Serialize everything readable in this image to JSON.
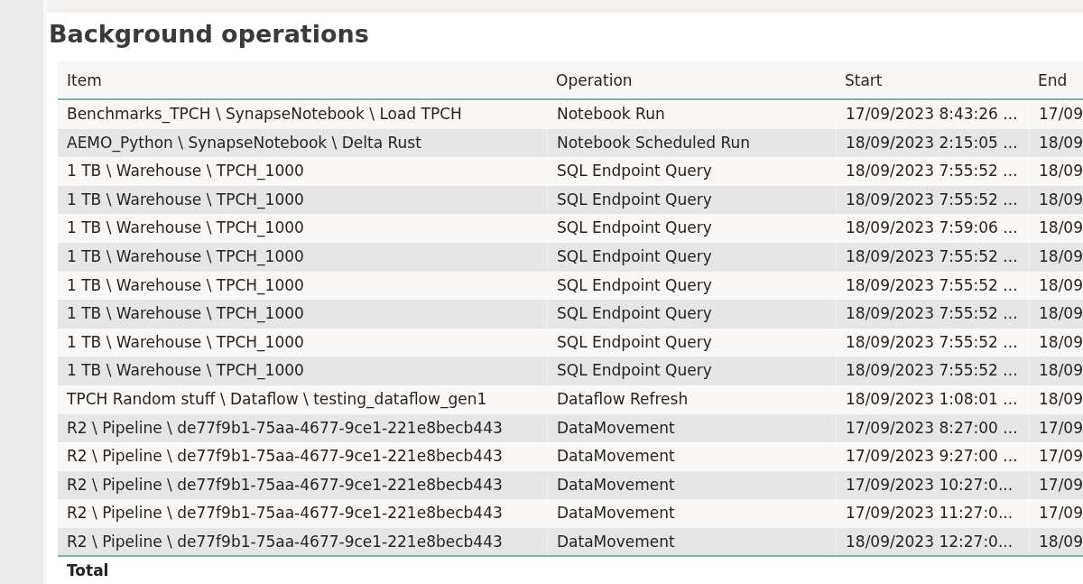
{
  "title": "Background operations",
  "table": {
    "columns": [
      "Item",
      "Operation",
      "Start",
      "End"
    ],
    "rows": [
      [
        "Benchmarks_TPCH \\ SynapseNotebook \\ Load TPCH",
        "Notebook Run",
        "17/09/2023 8:43:26 ...",
        "17/09"
      ],
      [
        "AEMO_Python \\ SynapseNotebook \\ Delta Rust",
        "Notebook Scheduled Run",
        "18/09/2023 2:15:05 ...",
        "18/09"
      ],
      [
        "1 TB \\ Warehouse \\ TPCH_1000",
        "SQL Endpoint Query",
        "18/09/2023 7:55:52 ...",
        "18/09"
      ],
      [
        "1 TB \\ Warehouse \\ TPCH_1000",
        "SQL Endpoint Query",
        "18/09/2023 7:55:52 ...",
        "18/09"
      ],
      [
        "1 TB \\ Warehouse \\ TPCH_1000",
        "SQL Endpoint Query",
        "18/09/2023 7:59:06 ...",
        "18/09"
      ],
      [
        "1 TB \\ Warehouse \\ TPCH_1000",
        "SQL Endpoint Query",
        "18/09/2023 7:55:52 ...",
        "18/09"
      ],
      [
        "1 TB \\ Warehouse \\ TPCH_1000",
        "SQL Endpoint Query",
        "18/09/2023 7:55:52 ...",
        "18/09"
      ],
      [
        "1 TB \\ Warehouse \\ TPCH_1000",
        "SQL Endpoint Query",
        "18/09/2023 7:55:52 ...",
        "18/09"
      ],
      [
        "1 TB \\ Warehouse \\ TPCH_1000",
        "SQL Endpoint Query",
        "18/09/2023 7:55:52 ...",
        "18/09"
      ],
      [
        "1 TB \\ Warehouse \\ TPCH_1000",
        "SQL Endpoint Query",
        "18/09/2023 7:55:52 ...",
        "18/09"
      ],
      [
        "TPCH Random stuff \\ Dataflow \\ testing_dataflow_gen1",
        "Dataflow Refresh",
        "18/09/2023 1:08:01 ...",
        "18/09"
      ],
      [
        "R2 \\ Pipeline \\ de77f9b1-75aa-4677-9ce1-221e8becb443",
        "DataMovement",
        "17/09/2023 8:27:00 ...",
        "17/09"
      ],
      [
        "R2 \\ Pipeline \\ de77f9b1-75aa-4677-9ce1-221e8becb443",
        "DataMovement",
        "17/09/2023 9:27:00 ...",
        "17/09"
      ],
      [
        "R2 \\ Pipeline \\ de77f9b1-75aa-4677-9ce1-221e8becb443",
        "DataMovement",
        "17/09/2023 10:27:0...",
        "17/09"
      ],
      [
        "R2 \\ Pipeline \\ de77f9b1-75aa-4677-9ce1-221e8becb443",
        "DataMovement",
        "17/09/2023 11:27:0...",
        "17/09"
      ],
      [
        "R2 \\ Pipeline \\ de77f9b1-75aa-4677-9ce1-221e8becb443",
        "DataMovement",
        "18/09/2023 12:27:0...",
        "18/09"
      ]
    ],
    "total_label": "Total"
  }
}
